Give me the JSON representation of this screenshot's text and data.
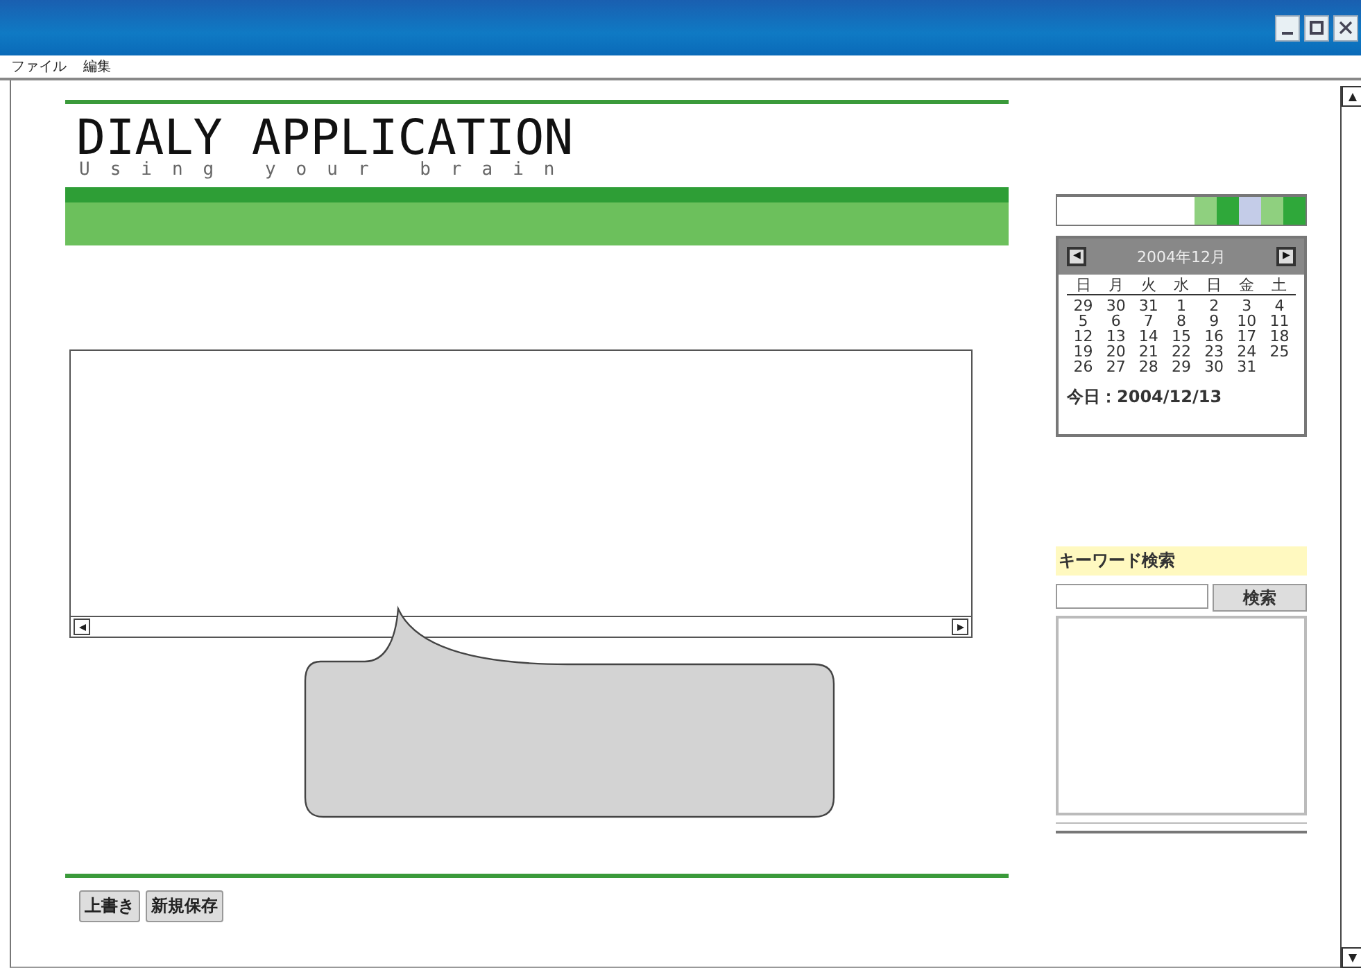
{
  "menu": [
    "ファイル",
    "編集"
  ],
  "header": {
    "title": "DIALY APPLICATION",
    "subtitle": "Using your brain"
  },
  "swatches": [
    {
      "color": "#8fd07f"
    },
    {
      "color": "#2fa83a"
    },
    {
      "color": "#c4cce8"
    },
    {
      "color": "#8fd07f"
    },
    {
      "color": "#2fa83a"
    }
  ],
  "calendar": {
    "prev": "◀",
    "month": "2004年12月",
    "next": "▶",
    "weekdays": [
      "日",
      "月",
      "火",
      "水",
      "日",
      "金",
      "土"
    ],
    "weeks": [
      [
        "29",
        "30",
        "31",
        "1",
        "2",
        "3",
        "4"
      ],
      [
        "5",
        "6",
        "7",
        "8",
        "9",
        "10",
        "11"
      ],
      [
        "12",
        "13",
        "14",
        "15",
        "16",
        "17",
        "18"
      ],
      [
        "19",
        "20",
        "21",
        "22",
        "23",
        "24",
        "25"
      ],
      [
        "26",
        "27",
        "28",
        "29",
        "30",
        "31"
      ]
    ],
    "today": "今日：2004/12/13"
  },
  "keyword_search": {
    "label": "キーワード検索",
    "button": "検索"
  },
  "buttons": [
    "上書き",
    "新規保存"
  ]
}
